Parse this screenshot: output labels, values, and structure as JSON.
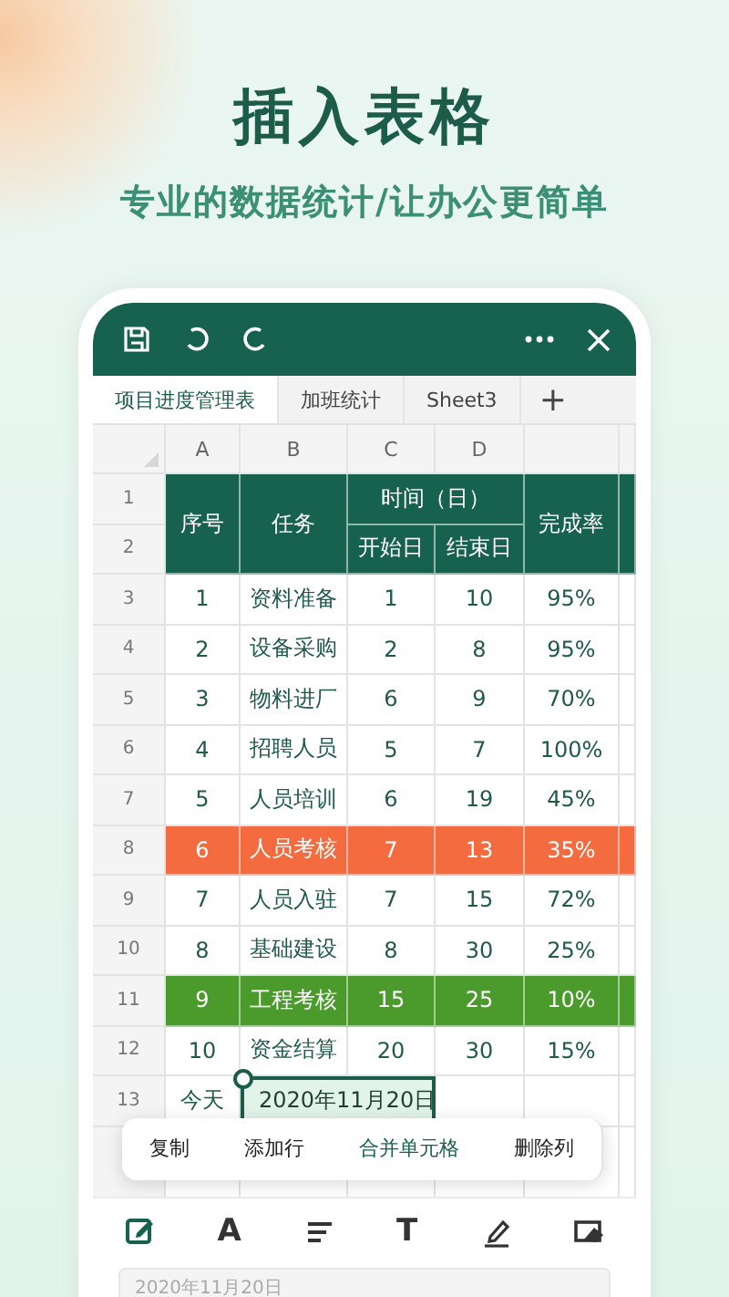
{
  "title": "插入表格",
  "subtitle": "专业的数据统计/让办公更简单",
  "sheet_tabs": [
    {
      "label": "项目进度管理表",
      "selected": true
    },
    {
      "label": "加班统计",
      "selected": false
    },
    {
      "label": "Sheet3",
      "selected": false
    }
  ],
  "add_tab": "+",
  "column_headers": [
    "A",
    "B",
    "C",
    "D"
  ],
  "table": {
    "header": {
      "index": "序号",
      "task": "任务",
      "time": "时间（日）",
      "start": "开始日",
      "end": "结束日",
      "rate": "完成率"
    },
    "header_row_numbers": [
      "1",
      "2"
    ],
    "rows": [
      {
        "row_number": "3",
        "cells": [
          "1",
          "资料准备",
          "1",
          "10",
          "95%"
        ]
      },
      {
        "row_number": "4",
        "cells": [
          "2",
          "设备采购",
          "2",
          "8",
          "95%"
        ]
      },
      {
        "row_number": "5",
        "cells": [
          "3",
          "物料进厂",
          "6",
          "9",
          "70%"
        ]
      },
      {
        "row_number": "6",
        "cells": [
          "4",
          "招聘人员",
          "5",
          "7",
          "100%"
        ]
      },
      {
        "row_number": "7",
        "cells": [
          "5",
          "人员培训",
          "6",
          "19",
          "45%"
        ]
      },
      {
        "row_number": "8",
        "cells": [
          "6",
          "人员考核",
          "7",
          "13",
          "35%"
        ],
        "color": "#f36b3f"
      },
      {
        "row_number": "9",
        "cells": [
          "7",
          "人员入驻",
          "7",
          "15",
          "72%"
        ]
      },
      {
        "row_number": "10",
        "cells": [
          "8",
          "基础建设",
          "8",
          "30",
          "25%"
        ]
      },
      {
        "row_number": "11",
        "cells": [
          "9",
          "工程考核",
          "15",
          "25",
          "10%"
        ],
        "color": "#4a9b2c"
      },
      {
        "row_number": "12",
        "cells": [
          "10",
          "资金结算",
          "20",
          "30",
          "15%"
        ]
      }
    ]
  },
  "today_row": {
    "row_number": "13",
    "label": "今天",
    "value": "2020年11月20日",
    "selected": true
  },
  "context_menu": [
    {
      "label": "复制",
      "selected": false
    },
    {
      "label": "添加行",
      "selected": false
    },
    {
      "label": "合并单元格",
      "selected": true
    },
    {
      "label": "删除列",
      "selected": false
    }
  ],
  "format_tools": [
    {
      "kind": "edit",
      "selected": true
    },
    {
      "kind": "font",
      "glyph": "A",
      "selected": false
    },
    {
      "kind": "align",
      "selected": false
    },
    {
      "kind": "text",
      "glyph": "T",
      "selected": false
    },
    {
      "kind": "highlight",
      "selected": false
    },
    {
      "kind": "fill",
      "selected": false
    }
  ],
  "input": {
    "value": "2020年11月20日"
  }
}
